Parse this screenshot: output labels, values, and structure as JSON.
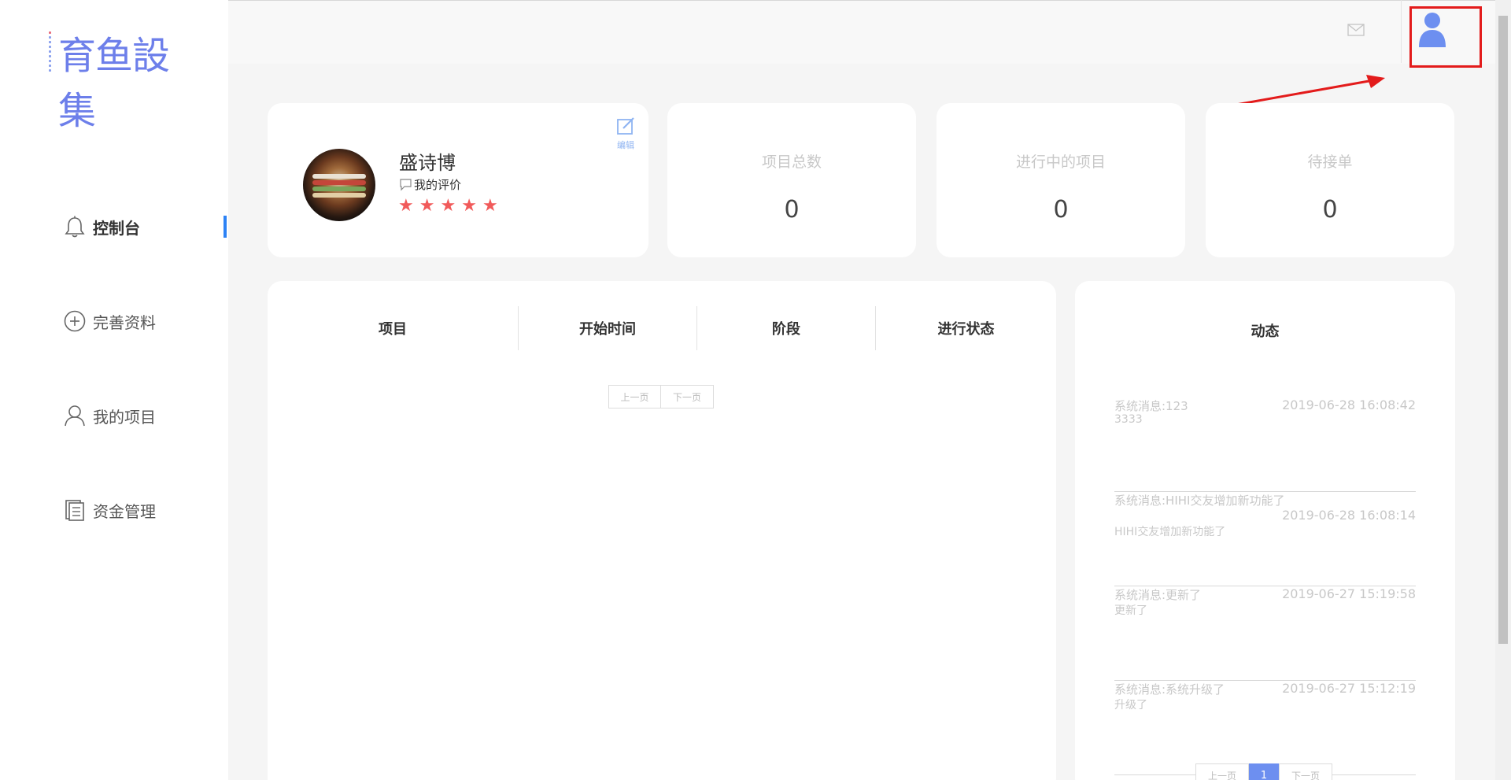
{
  "sidebar": {
    "logo_text": "育鱼設集",
    "items": [
      {
        "label": "控制台",
        "icon": "bell-icon",
        "active": true
      },
      {
        "label": "完善资料",
        "icon": "plus-circle-icon",
        "active": false
      },
      {
        "label": "我的项目",
        "icon": "user-icon",
        "active": false
      },
      {
        "label": "资金管理",
        "icon": "document-icon",
        "active": false
      }
    ]
  },
  "header": {
    "mail_icon": "mail-icon",
    "avatar_icon": "user-avatar-icon",
    "annotation_color": "#e31b1b"
  },
  "profile": {
    "name": "盛诗博",
    "review_label": "我的评价",
    "rating": 5,
    "rating_max": 5,
    "stars": [
      "★",
      "★",
      "★",
      "★",
      "★"
    ],
    "edit_label": "编辑"
  },
  "stats": [
    {
      "title": "项目总数",
      "value": "0"
    },
    {
      "title": "进行中的项目",
      "value": "0"
    },
    {
      "title": "待接单",
      "value": "0"
    }
  ],
  "projects_table": {
    "columns": [
      "项目",
      "开始时间",
      "阶段",
      "进行状态"
    ],
    "prev_label": "上一页",
    "next_label": "下一页"
  },
  "feed": {
    "title": "动态",
    "messages": [
      {
        "title": "系统消息:123",
        "body": "3333",
        "date": "2019-06-28 16:08:42"
      },
      {
        "title": "系统消息:HIHI交友增加新功能了",
        "body": "HIHI交友增加新功能了",
        "date": "2019-06-28 16:08:14"
      },
      {
        "title": "系统消息:更新了",
        "body": "更新了",
        "date": "2019-06-27 15:19:58"
      },
      {
        "title": "系统消息:系统升级了",
        "body": "升级了",
        "date": "2019-06-27 15:12:19"
      }
    ],
    "prev_label": "上一页",
    "current_page": "1",
    "next_label": "下一页"
  },
  "colors": {
    "accent": "#2c82f5",
    "logo": "#6d7fea",
    "star": "#f15a5a",
    "page_active": "#6d8ff0"
  }
}
